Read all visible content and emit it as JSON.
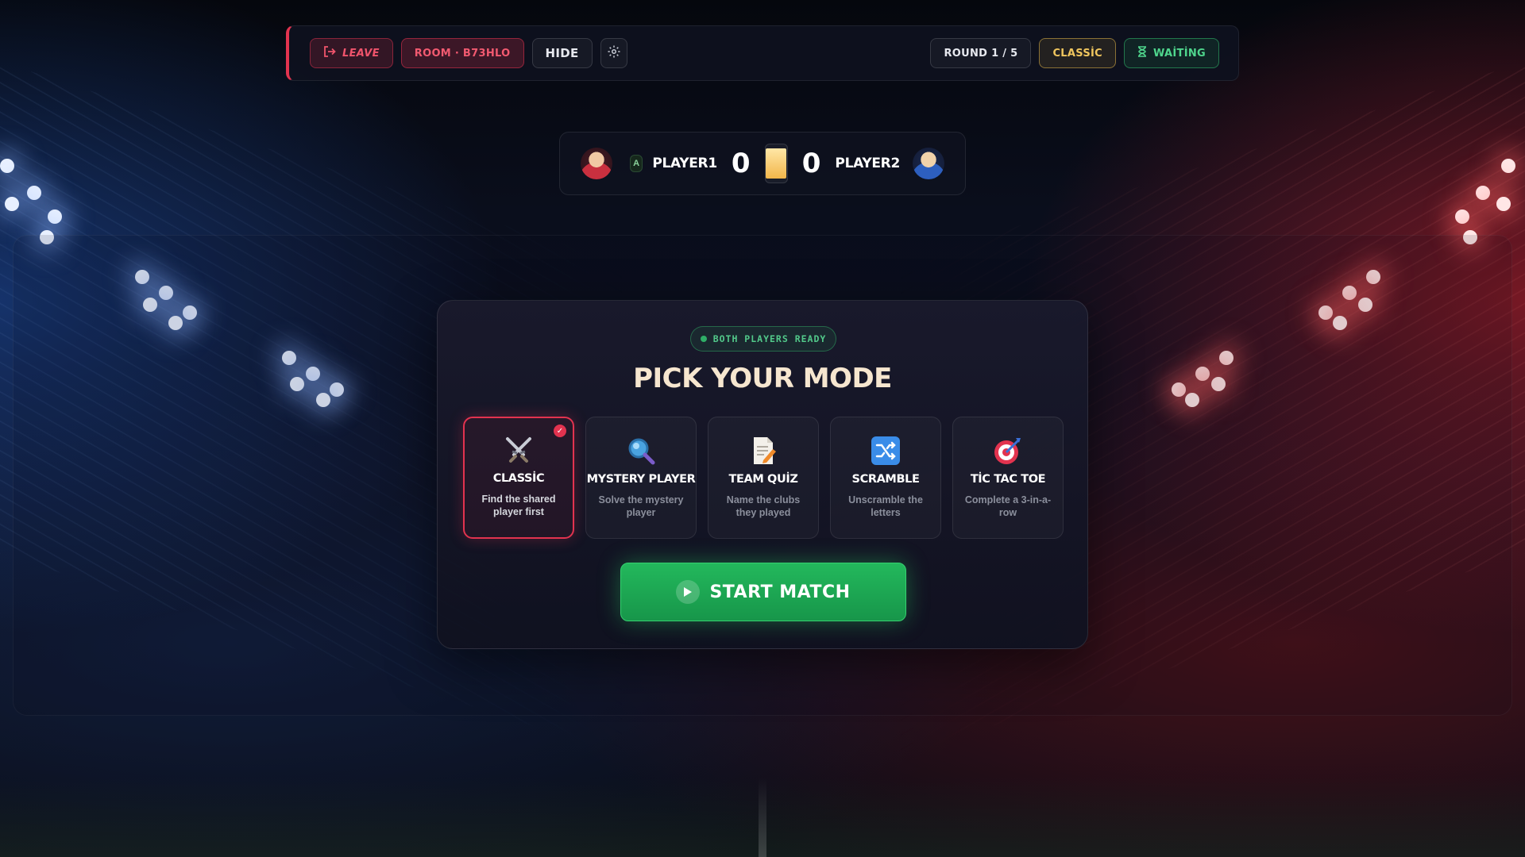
{
  "topbar": {
    "leave_label": "LEAVE",
    "room_label": "ROOM · B73HLO",
    "hide_label": "HIDE",
    "round_label": "ROUND 1 / 5",
    "mode_label": "CLASSİC",
    "status_label": "WAİTİNG"
  },
  "scoreboard": {
    "player1": {
      "badge": "A",
      "name": "PLAYER1",
      "score": "0"
    },
    "player2": {
      "name": "PLAYER2",
      "score": "0"
    }
  },
  "panel": {
    "ready_label": "BOTH PLAYERS READY",
    "title": "PICK YOUR MODE",
    "modes": [
      {
        "name": "CLASSİC",
        "desc": "Find the shared player first",
        "icon": "crossed-swords-icon",
        "selected": true
      },
      {
        "name": "MYSTERY PLAYER",
        "desc": "Solve the mystery player",
        "icon": "magnifier-icon",
        "selected": false
      },
      {
        "name": "TEAM QUİZ",
        "desc": "Name the clubs they played",
        "icon": "memo-icon",
        "selected": false
      },
      {
        "name": "SCRAMBLE",
        "desc": "Unscramble the letters",
        "icon": "shuffle-icon",
        "selected": false
      },
      {
        "name": "TİC TAC TOE",
        "desc": "Complete a 3-in-a-row",
        "icon": "target-icon",
        "selected": false
      }
    ],
    "start_label": "START MATCH"
  },
  "colors": {
    "accent_red": "#e2334f",
    "accent_green": "#23b85c",
    "accent_gold": "#f0c65e"
  }
}
